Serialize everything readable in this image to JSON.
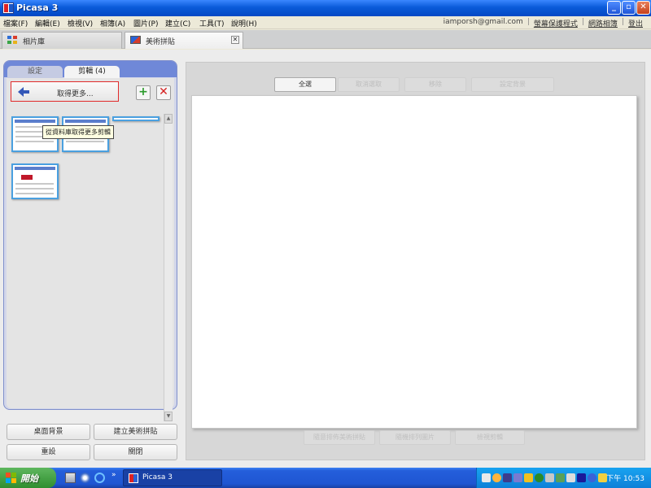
{
  "window": {
    "title": "Picasa 3"
  },
  "menu": {
    "items": [
      "檔案(F)",
      "編輯(E)",
      "檢視(V)",
      "相簿(A)",
      "圖片(P)",
      "建立(C)",
      "工具(T)",
      "說明(H)"
    ],
    "email": "iamporsh@gmail.com",
    "links": [
      "螢幕保護程式",
      "網路相簿",
      "登出"
    ]
  },
  "tabs": {
    "library": "相片庫",
    "collage": "美術拼貼"
  },
  "left_panel": {
    "tab_settings": "設定",
    "tab_clips": "剪輯 (4)",
    "get_more_label": "取得更多...",
    "add_symbol": "+",
    "remove_symbol": "✕",
    "tooltip": "從資料庫取得更多剪輯",
    "buttons": {
      "desktop": "桌面背景",
      "create": "建立美術拼貼",
      "reset": "重設",
      "close": "關閉"
    }
  },
  "canvas_toolbar": {
    "select_all": "全選",
    "deselect": "取消選取",
    "remove": "移除",
    "set_background": "設定背景"
  },
  "canvas_bottom": {
    "random": "隨意排佈美術拼貼",
    "shuffle": "隨機排列圖片",
    "check": "檢視剪輯"
  },
  "taskbar": {
    "start": "開始",
    "more": "»",
    "app": "Picasa 3",
    "clock": "下午 10:53"
  },
  "icons": {
    "app": "picasa-icon",
    "minimize": "minimize-icon",
    "maximize": "maximize-icon",
    "close": "close-icon",
    "arrow": "back-arrow-icon"
  },
  "colors": {
    "titlebar": "#0a5bd9",
    "highlight_border": "#e12b2b",
    "thumb_border": "#4aa0e0"
  }
}
